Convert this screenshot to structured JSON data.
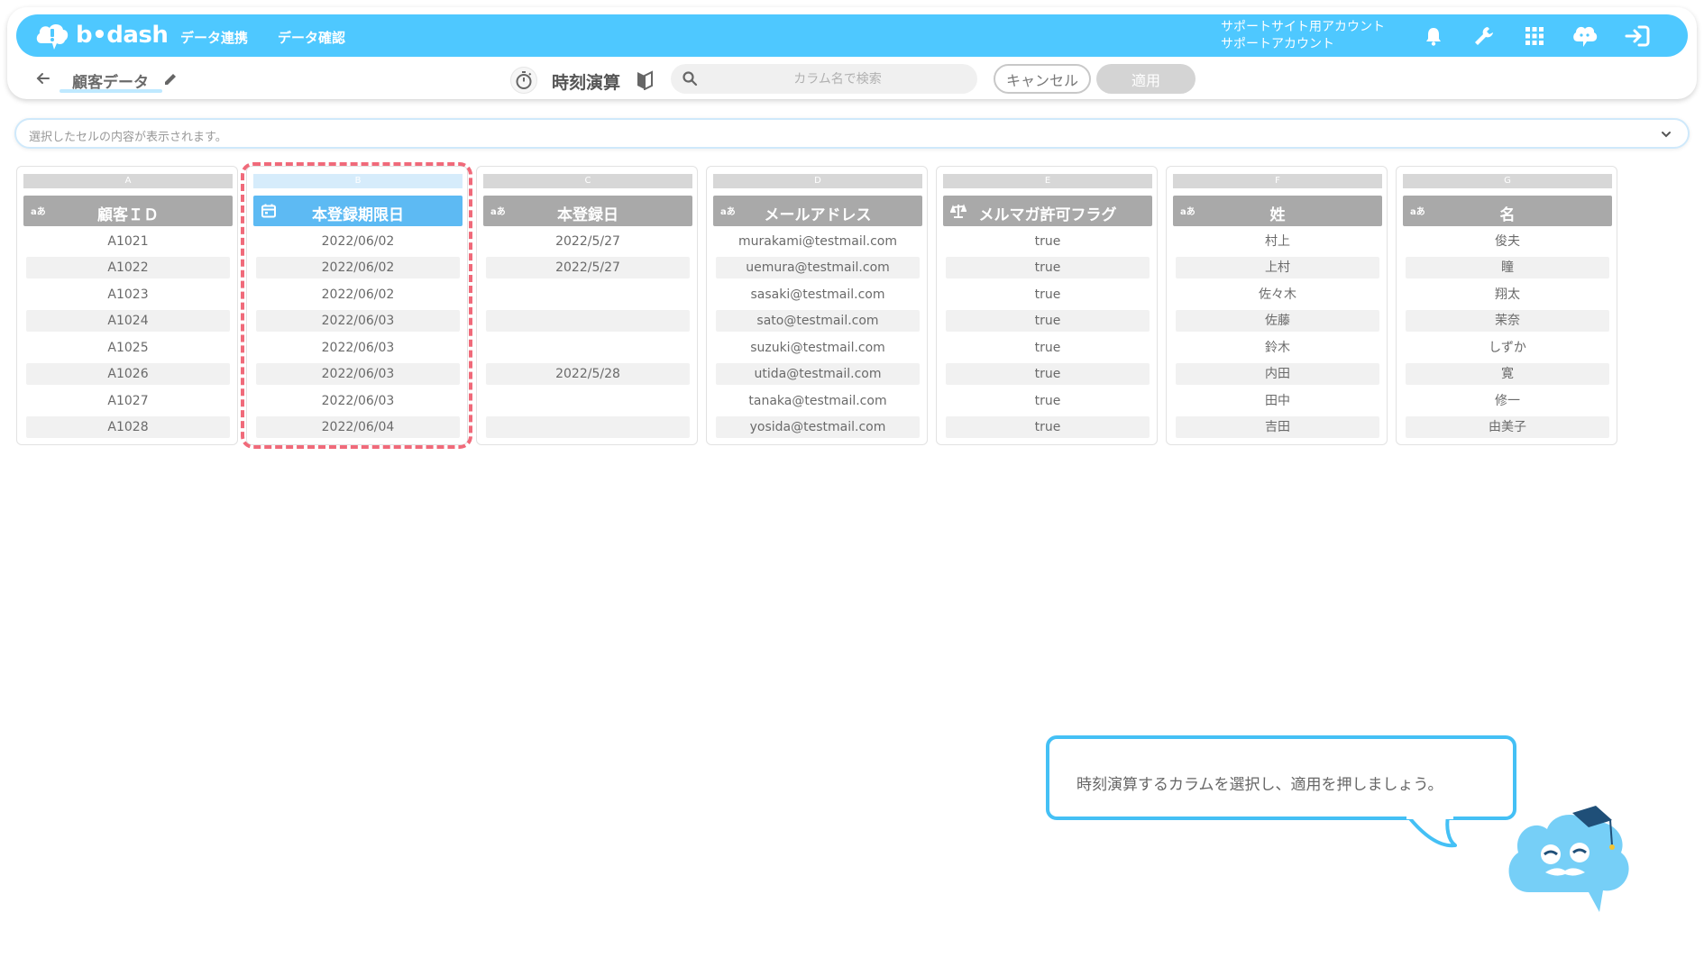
{
  "header": {
    "logo_text": "b•dash",
    "nav": [
      "データ連携",
      "データ確認"
    ],
    "account_line1": "サポートサイト用アカウント",
    "account_line2": "サポートアカウント",
    "icons": [
      "bell-icon",
      "wrench-icon",
      "grid-icon",
      "chat-icon",
      "logout-icon"
    ],
    "color": "#4ec8ff"
  },
  "toolbar": {
    "table_name": "顧客データ",
    "operation_title": "時刻演算",
    "search_placeholder": "カラム名で検索",
    "cancel_label": "キャンセル",
    "apply_label": "適用"
  },
  "cellbar": {
    "text": "選択したセルの内容が表示されます。"
  },
  "columns": [
    {
      "letter": "A",
      "title": "顧客ＩＤ",
      "type": "aあ",
      "selected": false,
      "values": [
        "A1021",
        "A1022",
        "A1023",
        "A1024",
        "A1025",
        "A1026",
        "A1027",
        "A1028"
      ]
    },
    {
      "letter": "B",
      "title": "本登録期限日",
      "type": "calendar",
      "selected": true,
      "values": [
        "2022/06/02",
        "2022/06/02",
        "2022/06/02",
        "2022/06/03",
        "2022/06/03",
        "2022/06/03",
        "2022/06/03",
        "2022/06/04"
      ]
    },
    {
      "letter": "C",
      "title": "本登録日",
      "type": "aあ",
      "selected": false,
      "values": [
        "2022/5/27",
        "2022/5/27",
        "",
        "",
        "",
        "2022/5/28",
        "",
        ""
      ]
    },
    {
      "letter": "D",
      "title": "メールアドレス",
      "type": "aあ",
      "selected": false,
      "values": [
        "murakami@testmail.com",
        "uemura@testmail.com",
        "sasaki@testmail.com",
        "sato@testmail.com",
        "suzuki@testmail.com",
        "utida@testmail.com",
        "tanaka@testmail.com",
        "yosida@testmail.com"
      ]
    },
    {
      "letter": "E",
      "title": "メルマガ許可フラグ",
      "type": "balance",
      "selected": false,
      "values": [
        "true",
        "true",
        "true",
        "true",
        "true",
        "true",
        "true",
        "true"
      ]
    },
    {
      "letter": "F",
      "title": "姓",
      "type": "aあ",
      "selected": false,
      "values": [
        "村上",
        "上村",
        "佐々木",
        "佐藤",
        "鈴木",
        "内田",
        "田中",
        "吉田"
      ]
    },
    {
      "letter": "G",
      "title": "名",
      "type": "aあ",
      "selected": false,
      "values": [
        "俊夫",
        "瞳",
        "翔太",
        "茉奈",
        "しずか",
        "寛",
        "修一",
        "由美子"
      ]
    }
  ],
  "tooltip": {
    "text": "時刻演算するカラムを選択し、適用を押しましょう。"
  },
  "colors": {
    "selection": "#f06a7a",
    "selected_header": "#5dbaf3",
    "header_gray": "#a9a9a9"
  }
}
